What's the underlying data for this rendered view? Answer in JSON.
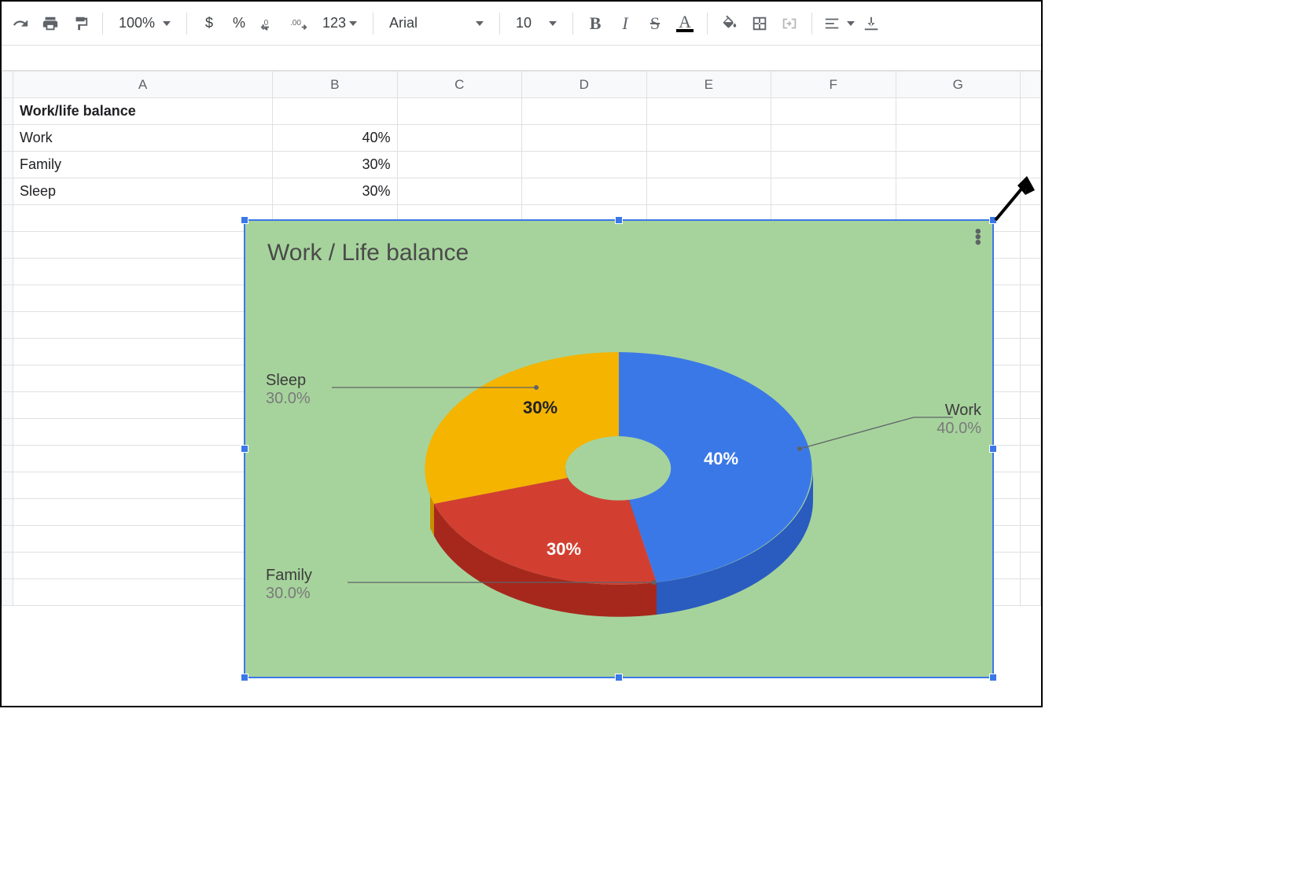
{
  "toolbar": {
    "zoom": "100%",
    "font": "Arial",
    "font_size": "10",
    "format_123": "123"
  },
  "columns": [
    "A",
    "B",
    "C",
    "D",
    "E",
    "F",
    "G"
  ],
  "cells": {
    "A1": "Work/life balance",
    "A2": "Work",
    "B2": "40%",
    "A3": "Family",
    "B3": "30%",
    "A4": "Sleep",
    "B4": "30%"
  },
  "chart": {
    "title": "Work / Life balance",
    "labels": {
      "work": {
        "name": "Work",
        "pct": "40.0%"
      },
      "family": {
        "name": "Family",
        "pct": "30.0%"
      },
      "sleep": {
        "name": "Sleep",
        "pct": "30.0%"
      }
    },
    "slice_text": {
      "work": "40%",
      "family": "30%",
      "sleep": "30%"
    }
  },
  "chart_data": {
    "type": "pie",
    "title": "Work / Life balance",
    "categories": [
      "Work",
      "Family",
      "Sleep"
    ],
    "values": [
      40,
      30,
      30
    ],
    "colors": [
      "#3b78e7",
      "#d23f31",
      "#f4b400"
    ],
    "donut_hole": 0.28,
    "style": "3d"
  }
}
